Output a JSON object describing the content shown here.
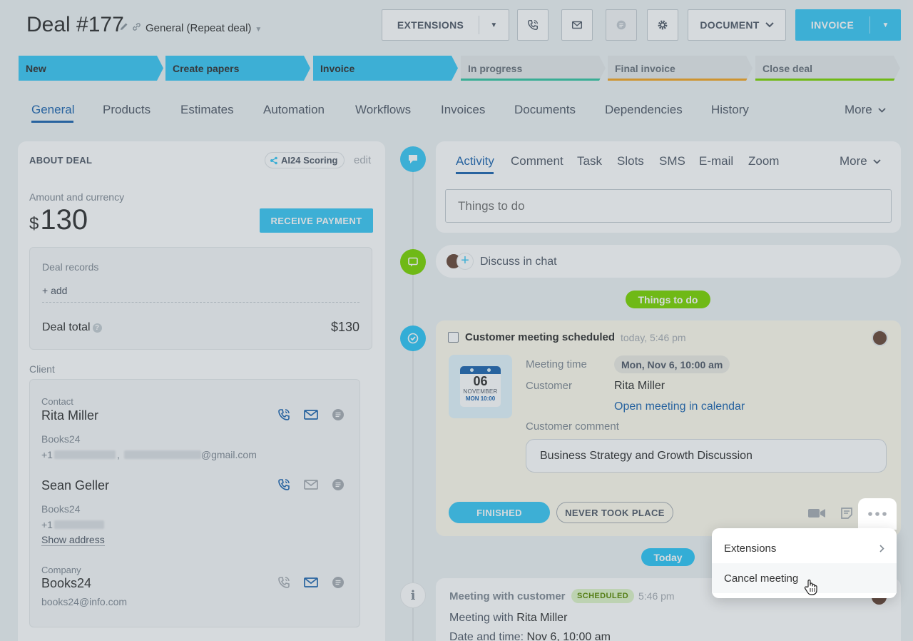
{
  "header": {
    "title": "Deal #177",
    "category": "General (Repeat deal)",
    "extensions_label": "EXTENSIONS",
    "document_label": "DOCUMENT",
    "invoice_label": "INVOICE"
  },
  "pipeline": {
    "stages": [
      {
        "label": "New",
        "status": "done"
      },
      {
        "label": "Create papers",
        "status": "done"
      },
      {
        "label": "Invoice",
        "status": "current"
      },
      {
        "label": "In progress",
        "status": "pending",
        "color": "#36c6a3"
      },
      {
        "label": "Final invoice",
        "status": "pending",
        "color": "#f5a623"
      },
      {
        "label": "Close deal",
        "status": "pending",
        "color": "#7bd500"
      }
    ]
  },
  "tabs": {
    "items": [
      "General",
      "Products",
      "Estimates",
      "Automation",
      "Workflows",
      "Invoices",
      "Documents",
      "Dependencies",
      "History"
    ],
    "more": "More",
    "active": "General"
  },
  "about": {
    "title": "ABOUT DEAL",
    "scoring_label": "AI24 Scoring",
    "edit_label": "edit",
    "amount_label": "Amount and currency",
    "currency_symbol": "$",
    "amount": "130",
    "receive_payment": "RECEIVE PAYMENT",
    "records_label": "Deal records",
    "add_label": "+ add",
    "total_label": "Deal total",
    "total_value": "$130",
    "client_label": "Client"
  },
  "client": {
    "contact_label": "Contact",
    "contacts": [
      {
        "name": "Rita Miller",
        "company": "Books24",
        "phone_prefix": "+1",
        "email_suffix": "@gmail.com"
      },
      {
        "name": "Sean Geller",
        "company": "Books24",
        "phone_prefix": "+1",
        "show_address": "Show address"
      }
    ],
    "company_label": "Company",
    "company": {
      "name": "Books24",
      "email": "books24@info.com"
    }
  },
  "activity": {
    "tabs": [
      "Activity",
      "Comment",
      "Task",
      "Slots",
      "SMS",
      "E-mail",
      "Zoom"
    ],
    "more": "More",
    "active": "Activity",
    "placeholder": "Things to do",
    "discuss": "Discuss in chat",
    "things_to_do_divider": "Things to do",
    "today_divider": "Today"
  },
  "meeting_card": {
    "title": "Customer meeting scheduled",
    "time": "today, 5:46 pm",
    "calendar_day": "06",
    "calendar_month": "NOVEMBER",
    "calendar_weekday_time": "MON 10:00",
    "meeting_time_label": "Meeting time",
    "meeting_time_value": "Mon, Nov 6, 10:00 am",
    "customer_label": "Customer",
    "customer_value": "Rita Miller",
    "open_link": "Open meeting in calendar",
    "comment_label": "Customer comment",
    "comment_value": "Business Strategy and Growth Discussion",
    "finished_btn": "FINISHED",
    "never_btn": "NEVER TOOK PLACE"
  },
  "history_card": {
    "title": "Meeting with customer",
    "badge": "SCHEDULED",
    "time": "5:46 pm",
    "meeting_with_label": "Meeting with",
    "meeting_with_value": "Rita Miller",
    "date_label": "Date and time:",
    "date_value": "Nov 6, 10:00 am"
  },
  "menu": {
    "items": [
      "Extensions",
      "Cancel meeting"
    ]
  },
  "colors": {
    "accent": "#3bc8f5",
    "link": "#2067b0",
    "green": "#7bd500",
    "card_yellow": "#fffcee"
  }
}
